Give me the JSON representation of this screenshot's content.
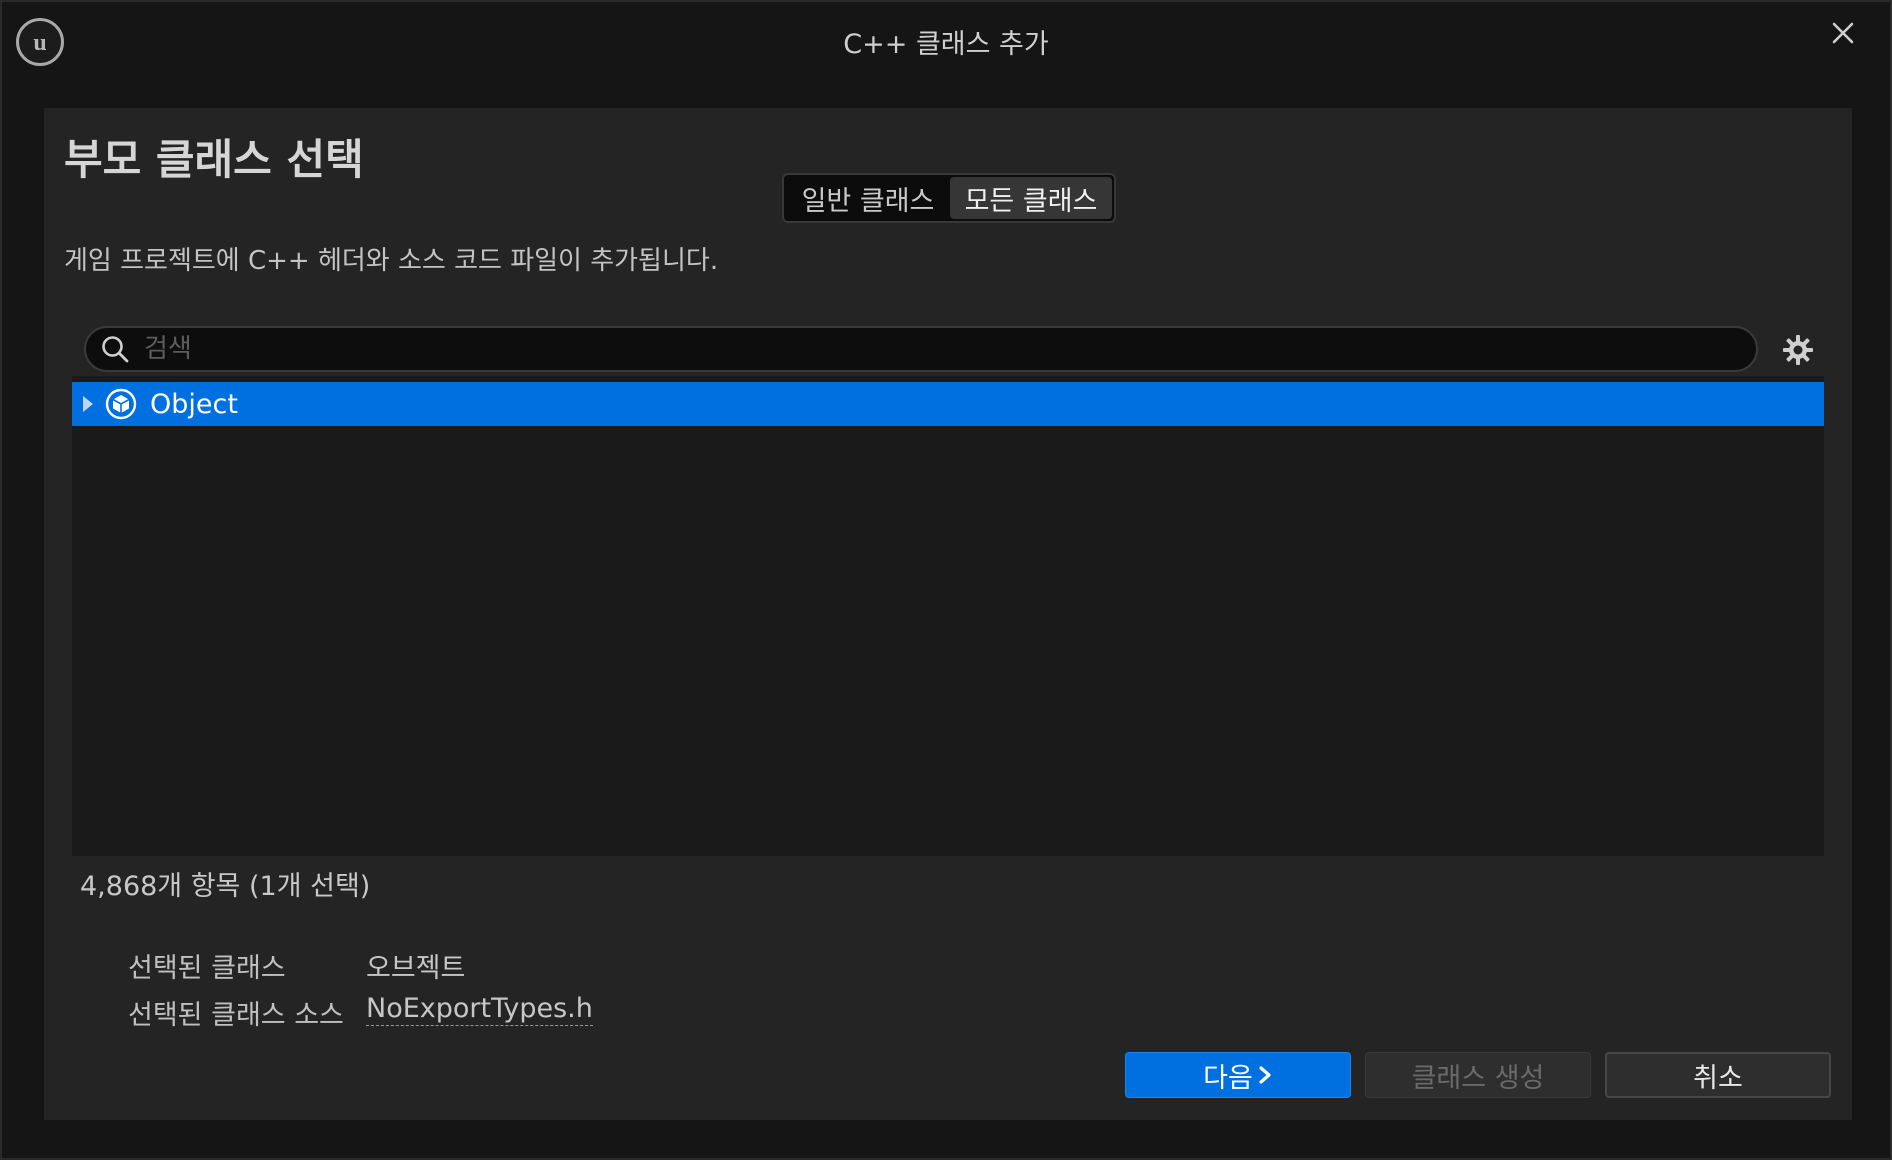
{
  "window": {
    "title": "C++ 클래스 추가"
  },
  "panel": {
    "heading": "부모 클래스 선택",
    "tabs": [
      {
        "label": "일반 클래스",
        "active": false
      },
      {
        "label": "모든 클래스",
        "active": true
      }
    ],
    "description": "게임 프로젝트에 C++ 헤더와 소스 코드 파일이 추가됩니다."
  },
  "search": {
    "placeholder": "검색",
    "value": ""
  },
  "tree": {
    "items": [
      {
        "label": "Object",
        "selected": true,
        "expandable": true,
        "icon": "object-class-icon"
      }
    ],
    "status": "4,868개 항목 (1개 선택)"
  },
  "selection": {
    "class_label": "선택된 클래스",
    "class_value": "오브젝트",
    "source_label": "선택된 클래스 소스",
    "source_value": "NoExportTypes.h"
  },
  "buttons": {
    "next": "다음",
    "create": "클래스 생성",
    "cancel": "취소"
  },
  "colors": {
    "accent": "#0070e0",
    "panel_bg": "#242424",
    "window_bg": "#151515"
  }
}
